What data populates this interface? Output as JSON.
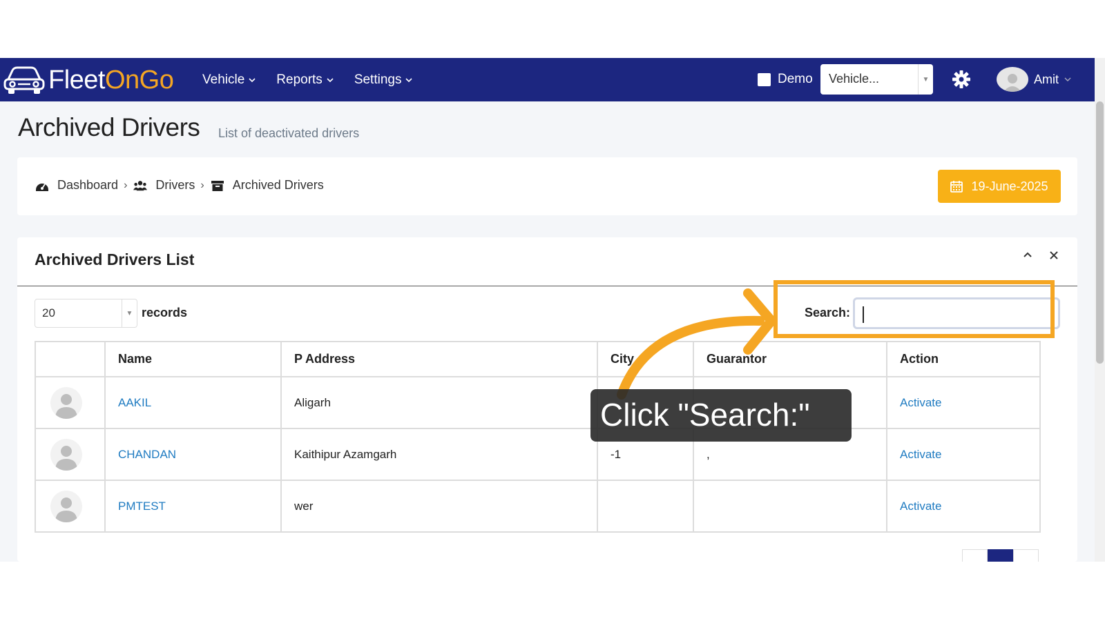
{
  "app": {
    "logo_main": "Fleet",
    "logo_accent": "OnGo"
  },
  "nav": {
    "items": [
      {
        "label": "Vehicle"
      },
      {
        "label": "Reports"
      },
      {
        "label": "Settings"
      }
    ],
    "demo_label": "Demo",
    "vehicle_select": "Vehicle...",
    "user_name": "Amit"
  },
  "header": {
    "title": "Archived Drivers",
    "subtitle": "List of deactivated drivers"
  },
  "breadcrumb": {
    "items": [
      {
        "label": "Dashboard",
        "icon": "dashboard-icon"
      },
      {
        "label": "Drivers",
        "icon": "users-icon"
      },
      {
        "label": "Archived Drivers",
        "icon": "archive-icon"
      }
    ]
  },
  "date_button": "19-June-2025",
  "card": {
    "title": "Archived Drivers List",
    "length_value": "20",
    "length_label": "records",
    "search_label": "Search:",
    "search_value": ""
  },
  "table": {
    "headers": [
      "",
      "Name",
      "P Address",
      "City",
      "Guarantor",
      "Action"
    ],
    "rows": [
      {
        "name": "AAKIL",
        "address": "Aligarh",
        "city": "",
        "guarantor": "",
        "action": "Activate"
      },
      {
        "name": "CHANDAN",
        "address": "Kaithipur Azamgarh",
        "city": "-1",
        "guarantor": ",",
        "action": "Activate"
      },
      {
        "name": "PMTEST",
        "address": "wer",
        "city": "",
        "guarantor": "",
        "action": "Activate"
      }
    ]
  },
  "annotation": {
    "text": "Click \"Search:\""
  },
  "colors": {
    "navbar": "#1c2680",
    "accent": "#f5a623",
    "link": "#1f7bc1",
    "date_button": "#f8b117"
  }
}
